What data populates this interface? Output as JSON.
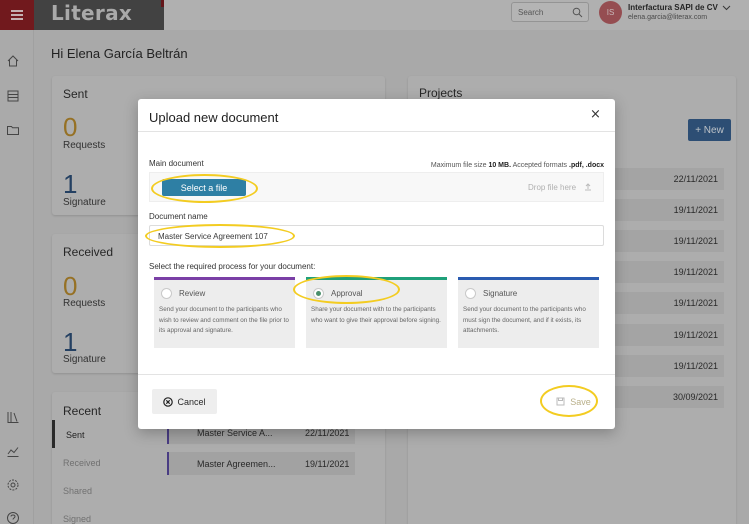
{
  "app": {
    "logo": "Literax"
  },
  "topbar": {
    "search_placeholder": "Search",
    "account_initials": "IS",
    "account_name": "Interfactura SAPI de CV",
    "account_email": "elena.garcia@literax.com"
  },
  "dashboard": {
    "greeting": "Hi Elena García Beltrán",
    "sent": {
      "title": "Sent",
      "requests_count": "0",
      "requests_label": "Requests",
      "signature_count": "1",
      "signature_label": "Signature"
    },
    "received": {
      "title": "Received",
      "requests_count": "0",
      "requests_label": "Requests",
      "signature_count": "1",
      "signature_label": "Signature"
    },
    "recent": {
      "title": "Recent",
      "tabs": [
        "Sent",
        "Received",
        "Shared",
        "Signed"
      ],
      "rows": [
        {
          "name": "Master Service A...",
          "date": "22/11/2021"
        },
        {
          "name": "Master Agreemen...",
          "date": "19/11/2021"
        }
      ]
    },
    "projects": {
      "title": "Projects",
      "new_label": "+ New",
      "dates": [
        "22/11/2021",
        "19/11/2021",
        "19/11/2021",
        "19/11/2021",
        "19/11/2021",
        "19/11/2021",
        "19/11/2021",
        "30/09/2021"
      ]
    }
  },
  "modal": {
    "title": "Upload new document",
    "close": "×",
    "main_label": "Main document",
    "max_prefix": "Maximum file size ",
    "max_size": "10 MB.",
    "formats_prefix": " Accepted formats ",
    "formats": ".pdf, .docx",
    "select_file": "Select a file",
    "drop_text": "Drop file here",
    "name_label": "Document name",
    "name_value": "Master Service Agreement 107",
    "process_label": "Select the required process for your document:",
    "processes": [
      {
        "title": "Review",
        "desc": "Send your document to the participants who wish to review and comment on the file prior to its approval and signature.",
        "color": "#7a3fa6",
        "selected": false
      },
      {
        "title": "Approval",
        "desc": "Share your document with to the participants who want to give their approval before signing.",
        "color": "#1fa07a",
        "selected": true
      },
      {
        "title": "Signature",
        "desc": "Send your document to the participants who must sign the document, and if it exists, its attachments.",
        "color": "#2a5bb0",
        "selected": false
      }
    ],
    "cancel": "Cancel",
    "save": "Save"
  }
}
